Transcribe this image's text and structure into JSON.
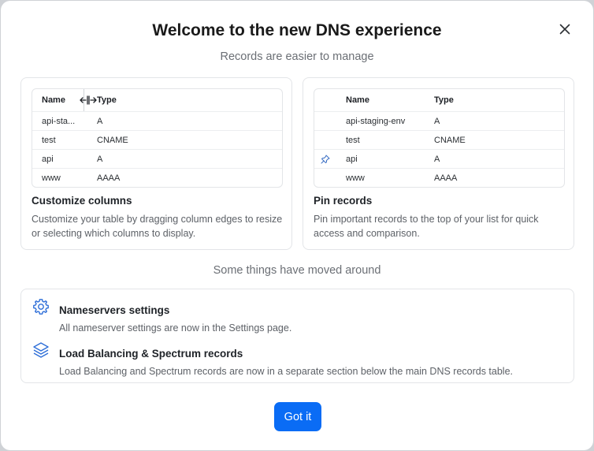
{
  "dialog": {
    "title": "Welcome to the new DNS experience",
    "subtitle": "Records are easier to manage",
    "close_icon": "close-icon"
  },
  "features": [
    {
      "title": "Customize columns",
      "description": "Customize your table by dragging column edges to resize or selecting which columns to display.",
      "table": {
        "headers": [
          "Name",
          "Type"
        ],
        "rows": [
          [
            "api-sta...",
            "A"
          ],
          [
            "test",
            "CNAME"
          ],
          [
            "api",
            "A"
          ],
          [
            "www",
            "AAAA"
          ]
        ]
      },
      "resize_icon": "column-resize-icon"
    },
    {
      "title": "Pin records",
      "description": "Pin important records to the top of your list for quick access and comparison.",
      "table": {
        "headers": [
          "Name",
          "Type"
        ],
        "rows": [
          [
            "api-staging-env",
            "A"
          ],
          [
            "test",
            "CNAME"
          ],
          [
            "api",
            "A"
          ],
          [
            "www",
            "AAAA"
          ]
        ]
      },
      "pinned_row_index": 2,
      "pin_icon": "pin-icon"
    }
  ],
  "moved": {
    "section_title": "Some things have moved around",
    "items": [
      {
        "icon": "gear-icon",
        "title": "Nameservers settings",
        "description": "All nameserver settings are now in the Settings page."
      },
      {
        "icon": "layers-icon",
        "title": "Load Balancing & Spectrum records",
        "description": "Load Balancing and Spectrum records are now in a separate section below the main DNS records table."
      }
    ]
  },
  "footer": {
    "confirm_label": "Got it"
  },
  "colors": {
    "accent": "#0a6cf5",
    "icon_blue": "#2f6fd8"
  }
}
